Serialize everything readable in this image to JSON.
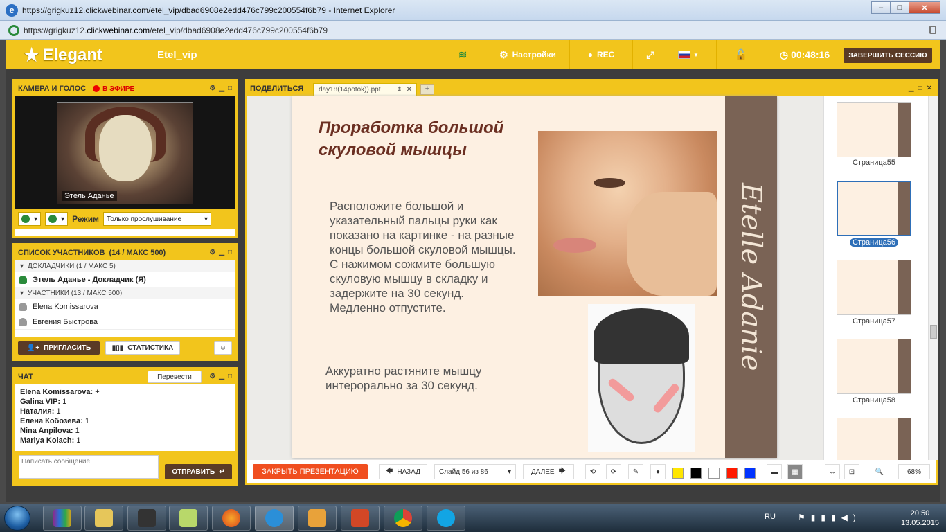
{
  "browser": {
    "title": "https://grigkuz12.clickwebinar.com/etel_vip/dbad6908e2edd476c799c200554f6b79 - Internet Explorer",
    "url_prefix": "https://grigkuz12.",
    "url_domain": "clickwebinar.com",
    "url_path": "/etel_vip/dbad6908e2edd476c799c200554f6b79"
  },
  "topbar": {
    "brand": "Elegant",
    "room": "Etel_vip",
    "settings": "Настройки",
    "rec": "REC",
    "timer": "00:48:16",
    "end_session": "ЗАВЕРШИТЬ СЕССИЮ"
  },
  "camera": {
    "title": "КАМЕРА И ГОЛОС",
    "live": "В ЭФИРЕ",
    "name": "Этель Аданье",
    "mode_label": "Режим",
    "mode_value": "Только прослушивание"
  },
  "participants": {
    "title": "СПИСОК УЧАСТНИКОВ",
    "count": "(14 / МАКС 500)",
    "presenters_header": "ДОКЛАДЧИКИ (1 / МАКС 5)",
    "presenter": "Этель Аданье - Докладчик (Я)",
    "attendees_header": "УЧАСТНИКИ (13 / МАКС 500)",
    "attendees": [
      "Elena Komissarova",
      "Евгения Быстрова"
    ],
    "invite": "ПРИГЛАСИТЬ",
    "stats": "СТАТИСТИКА"
  },
  "chat": {
    "title": "ЧАТ",
    "translate": "Перевести",
    "messages": [
      {
        "name": "Elena Komissarova:",
        "text": "+"
      },
      {
        "name": "Galina VIP:",
        "text": "1"
      },
      {
        "name": "Наталия:",
        "text": "1"
      },
      {
        "name": "Елена Кобозева:",
        "text": "1"
      },
      {
        "name": "Nina Anpilova:",
        "text": "1"
      },
      {
        "name": "Mariya Kolach:",
        "text": "1"
      }
    ],
    "placeholder": "Написать сообщение",
    "send": "ОТПРАВИТЬ"
  },
  "share": {
    "title": "ПОДЕЛИТЬСЯ",
    "tab": "day18(14potok)).ppt",
    "slide_title": "Проработка большой скуловой мышцы",
    "slide_text": "Расположите большой и указательный пальцы руки как показано на картинке - на разные концы большой скуловой мышцы.\nС нажимом сожмите большую скуловую мышцу в складку и задержите на 30 секунд. Медленно отпустите.",
    "slide_text2": "Аккуратно растяните мышцу интерорально за 30 секунд.",
    "strip_text": "Etelle Adanie",
    "thumbnails": [
      "Страница55",
      "Страница56",
      "Страница57",
      "Страница58"
    ],
    "close_presentation": "ЗАКРЫТЬ ПРЕЗЕНТАЦИЮ",
    "back": "НАЗАД",
    "slide_counter": "Слайд 56 из 86",
    "next": "ДАЛЕЕ",
    "zoom": "68%"
  },
  "colors": {
    "accent": "#f2c51c",
    "dark_button": "#5a3b26",
    "close_presentation": "#f04e1f",
    "palette": [
      "#ffe600",
      "#000000",
      "#ffffff",
      "#ff1a00",
      "#0033ff"
    ]
  },
  "taskbar": {
    "lang": "RU",
    "time": "20:50",
    "date": "13.05.2015"
  }
}
